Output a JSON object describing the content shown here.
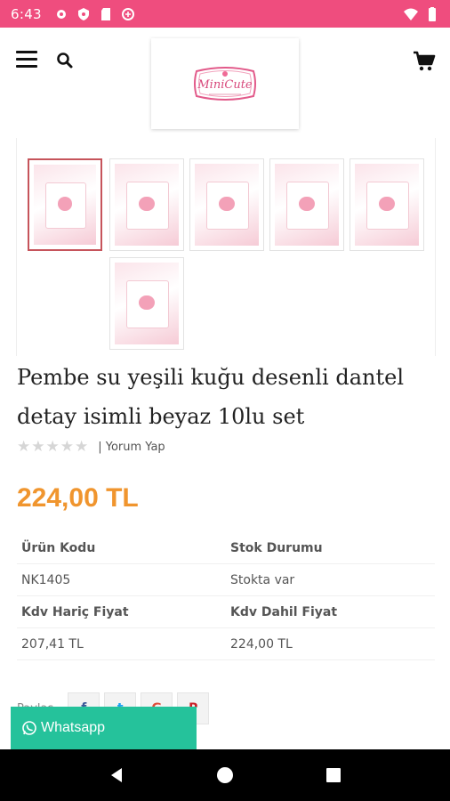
{
  "status_bar": {
    "time": "6:43",
    "icons": [
      "settings-icon",
      "shield-icon",
      "sd-card-icon",
      "data-saver-icon"
    ],
    "right_icons": [
      "wifi-icon",
      "battery-icon"
    ]
  },
  "header": {
    "logo_text": "MiniCute",
    "menu_icon": "hamburger-menu-icon",
    "search_icon": "search-icon",
    "cart_icon": "cart-icon"
  },
  "gallery": {
    "thumbnail_count": 6,
    "active_index": 0
  },
  "product": {
    "title": "Pembe su yeşili kuğu desenli dantel detay isimli beyaz 10lu set",
    "review_link": "| Yorum Yap",
    "rating": 0,
    "rating_max": 5,
    "price": "224,00 TL"
  },
  "info": {
    "code_label": "Ürün Kodu",
    "stock_label": "Stok Durumu",
    "code_value": "NK1405",
    "stock_value": "Stokta var",
    "price_excl_label": "Kdv Hariç Fiyat",
    "price_incl_label": "Kdv Dahil Fiyat",
    "price_excl_value": "207,41 TL",
    "price_incl_value": "224,00 TL"
  },
  "share": {
    "label": "Paylaş",
    "buttons": [
      "f",
      "t",
      "G",
      "P"
    ]
  },
  "whatsapp": {
    "label": "Whatsapp"
  },
  "colors": {
    "status_bar": "#ef4d7e",
    "price": "#f0952e",
    "whatsapp": "#25c29b",
    "active_thumb_border": "#c6545b"
  }
}
